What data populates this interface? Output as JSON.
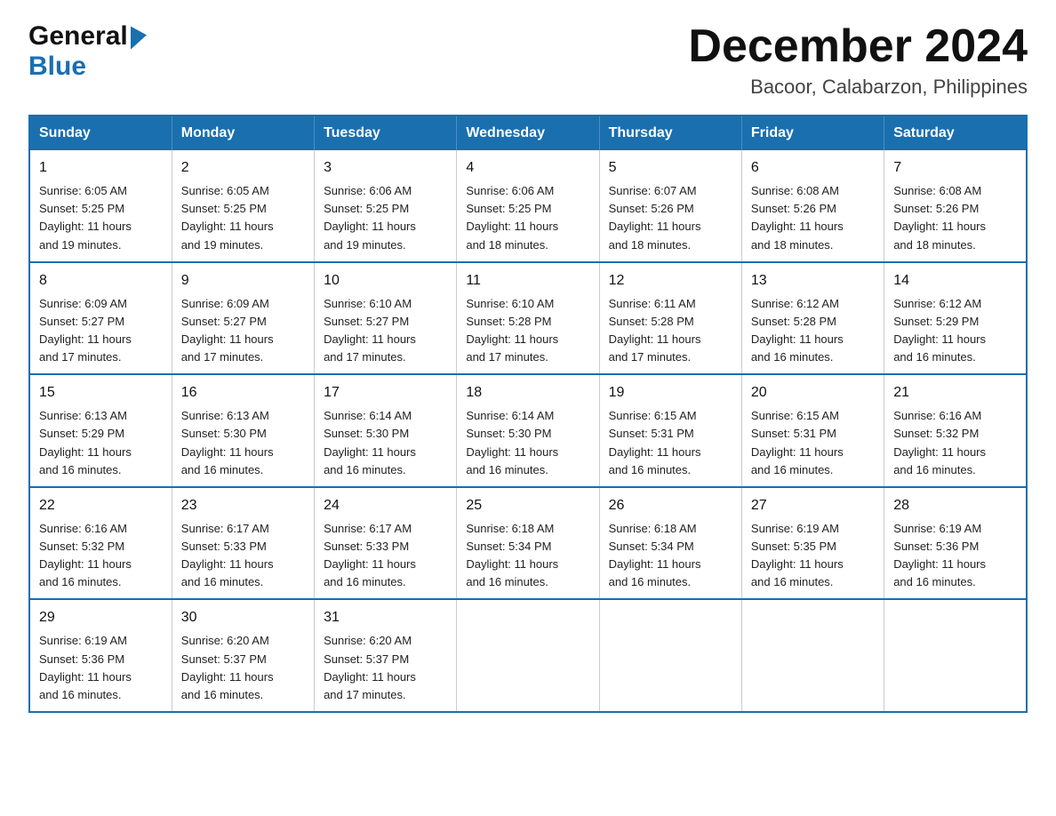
{
  "logo": {
    "general": "General",
    "blue": "Blue"
  },
  "title": "December 2024",
  "subtitle": "Bacoor, Calabarzon, Philippines",
  "days_of_week": [
    "Sunday",
    "Monday",
    "Tuesday",
    "Wednesday",
    "Thursday",
    "Friday",
    "Saturday"
  ],
  "weeks": [
    [
      {
        "date": "1",
        "sunrise": "6:05 AM",
        "sunset": "5:25 PM",
        "daylight": "11 hours and 19 minutes."
      },
      {
        "date": "2",
        "sunrise": "6:05 AM",
        "sunset": "5:25 PM",
        "daylight": "11 hours and 19 minutes."
      },
      {
        "date": "3",
        "sunrise": "6:06 AM",
        "sunset": "5:25 PM",
        "daylight": "11 hours and 19 minutes."
      },
      {
        "date": "4",
        "sunrise": "6:06 AM",
        "sunset": "5:25 PM",
        "daylight": "11 hours and 18 minutes."
      },
      {
        "date": "5",
        "sunrise": "6:07 AM",
        "sunset": "5:26 PM",
        "daylight": "11 hours and 18 minutes."
      },
      {
        "date": "6",
        "sunrise": "6:08 AM",
        "sunset": "5:26 PM",
        "daylight": "11 hours and 18 minutes."
      },
      {
        "date": "7",
        "sunrise": "6:08 AM",
        "sunset": "5:26 PM",
        "daylight": "11 hours and 18 minutes."
      }
    ],
    [
      {
        "date": "8",
        "sunrise": "6:09 AM",
        "sunset": "5:27 PM",
        "daylight": "11 hours and 17 minutes."
      },
      {
        "date": "9",
        "sunrise": "6:09 AM",
        "sunset": "5:27 PM",
        "daylight": "11 hours and 17 minutes."
      },
      {
        "date": "10",
        "sunrise": "6:10 AM",
        "sunset": "5:27 PM",
        "daylight": "11 hours and 17 minutes."
      },
      {
        "date": "11",
        "sunrise": "6:10 AM",
        "sunset": "5:28 PM",
        "daylight": "11 hours and 17 minutes."
      },
      {
        "date": "12",
        "sunrise": "6:11 AM",
        "sunset": "5:28 PM",
        "daylight": "11 hours and 17 minutes."
      },
      {
        "date": "13",
        "sunrise": "6:12 AM",
        "sunset": "5:28 PM",
        "daylight": "11 hours and 16 minutes."
      },
      {
        "date": "14",
        "sunrise": "6:12 AM",
        "sunset": "5:29 PM",
        "daylight": "11 hours and 16 minutes."
      }
    ],
    [
      {
        "date": "15",
        "sunrise": "6:13 AM",
        "sunset": "5:29 PM",
        "daylight": "11 hours and 16 minutes."
      },
      {
        "date": "16",
        "sunrise": "6:13 AM",
        "sunset": "5:30 PM",
        "daylight": "11 hours and 16 minutes."
      },
      {
        "date": "17",
        "sunrise": "6:14 AM",
        "sunset": "5:30 PM",
        "daylight": "11 hours and 16 minutes."
      },
      {
        "date": "18",
        "sunrise": "6:14 AM",
        "sunset": "5:30 PM",
        "daylight": "11 hours and 16 minutes."
      },
      {
        "date": "19",
        "sunrise": "6:15 AM",
        "sunset": "5:31 PM",
        "daylight": "11 hours and 16 minutes."
      },
      {
        "date": "20",
        "sunrise": "6:15 AM",
        "sunset": "5:31 PM",
        "daylight": "11 hours and 16 minutes."
      },
      {
        "date": "21",
        "sunrise": "6:16 AM",
        "sunset": "5:32 PM",
        "daylight": "11 hours and 16 minutes."
      }
    ],
    [
      {
        "date": "22",
        "sunrise": "6:16 AM",
        "sunset": "5:32 PM",
        "daylight": "11 hours and 16 minutes."
      },
      {
        "date": "23",
        "sunrise": "6:17 AM",
        "sunset": "5:33 PM",
        "daylight": "11 hours and 16 minutes."
      },
      {
        "date": "24",
        "sunrise": "6:17 AM",
        "sunset": "5:33 PM",
        "daylight": "11 hours and 16 minutes."
      },
      {
        "date": "25",
        "sunrise": "6:18 AM",
        "sunset": "5:34 PM",
        "daylight": "11 hours and 16 minutes."
      },
      {
        "date": "26",
        "sunrise": "6:18 AM",
        "sunset": "5:34 PM",
        "daylight": "11 hours and 16 minutes."
      },
      {
        "date": "27",
        "sunrise": "6:19 AM",
        "sunset": "5:35 PM",
        "daylight": "11 hours and 16 minutes."
      },
      {
        "date": "28",
        "sunrise": "6:19 AM",
        "sunset": "5:36 PM",
        "daylight": "11 hours and 16 minutes."
      }
    ],
    [
      {
        "date": "29",
        "sunrise": "6:19 AM",
        "sunset": "5:36 PM",
        "daylight": "11 hours and 16 minutes."
      },
      {
        "date": "30",
        "sunrise": "6:20 AM",
        "sunset": "5:37 PM",
        "daylight": "11 hours and 16 minutes."
      },
      {
        "date": "31",
        "sunrise": "6:20 AM",
        "sunset": "5:37 PM",
        "daylight": "11 hours and 17 minutes."
      },
      null,
      null,
      null,
      null
    ]
  ],
  "labels": {
    "sunrise": "Sunrise:",
    "sunset": "Sunset:",
    "daylight": "Daylight:"
  }
}
